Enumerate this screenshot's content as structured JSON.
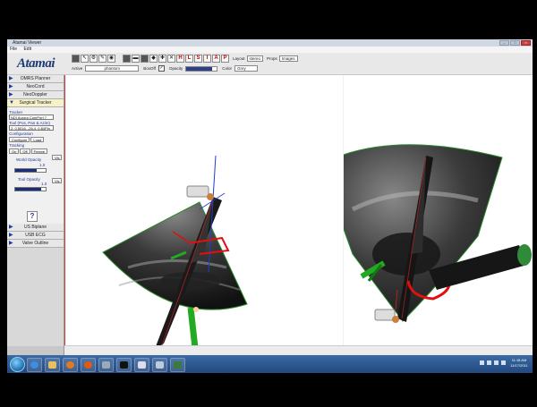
{
  "window": {
    "title": "Atamai Viewer"
  },
  "menu": [
    "File",
    "Edit"
  ],
  "logo": "Atamai",
  "toolbar": {
    "buttons": [
      "H",
      "L",
      "S",
      "I",
      "A",
      "P"
    ],
    "layout_label": "Layout",
    "layout_value": "stereo",
    "props_label": "Props",
    "props_value": "Images",
    "active_label": "Active",
    "active_value": "phantom",
    "box_label": "BoxOff",
    "opacity_label": "Opacity",
    "opacity_level": 0.85,
    "color_label": "Color",
    "color_value": "Grey"
  },
  "sidebar": {
    "items_top": [
      "OMRS Planner",
      "NeoCord",
      "NeoDoppler",
      "Surgical Tracker"
    ],
    "items_bottom": [
      "US Biplane",
      "USB ECG",
      "Valve Outline"
    ],
    "tracker_label": "Tracker",
    "tracker_value": "NDI Aurora ComPort 7",
    "toolpos_label": "Tool (Pos, Pan & Azim)",
    "toolpos_value": "2: 0.5016, -26.4, 0.84Pln",
    "config_label": "Configuration",
    "configure_btn": "Configure",
    "load_btn": "Load",
    "tracking_label": "Tracking",
    "on_btn": "On",
    "off_btn": "Off",
    "freeze_btn": "Freeze",
    "world_opacity_label": "World Opacity",
    "world_opacity_value": "1.0",
    "world_opacity_level": 0.7,
    "tool_opacity_label": "Tool Opacity",
    "tool_opacity_value": "1.0",
    "tool_opacity_level": 0.85,
    "vis_btn": "Vis",
    "help_btn": "?"
  },
  "taskbar": {
    "time": "11:18 AM",
    "date": "11/17/2011"
  },
  "colors": {
    "accent_blue": "#1f3a9a",
    "taskbar": "#2a558f"
  },
  "icons": [
    "windows-start-icon",
    "ie-icon",
    "explorer-icon",
    "media-icon",
    "firefox-icon",
    "misc-icon",
    "terminal-icon",
    "window-icon",
    "window-icon",
    "atamai-icon"
  ]
}
